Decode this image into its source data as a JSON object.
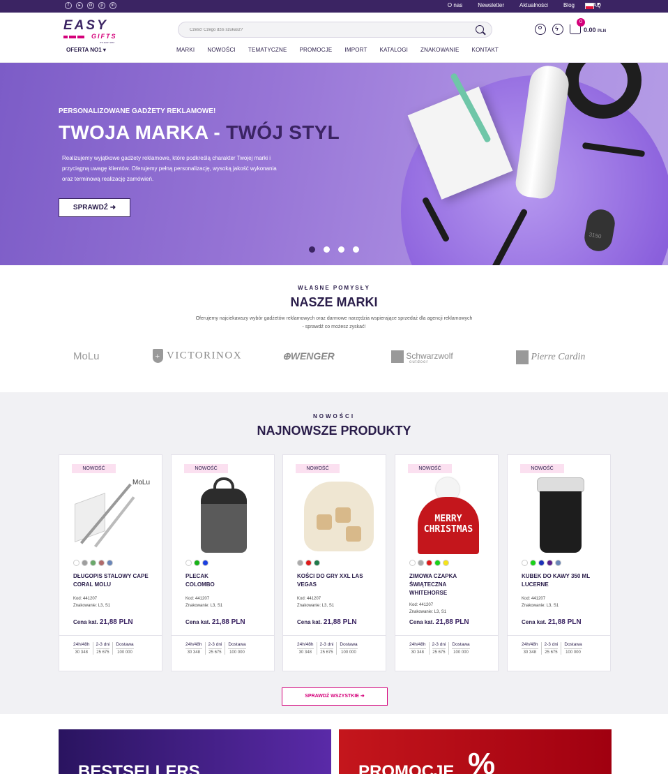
{
  "topbar": {
    "social": [
      "f",
      "yt",
      "ig",
      "pin",
      "in"
    ],
    "links": [
      "O nas",
      "Newsletter",
      "Aktualności",
      "Blog",
      "FAQ"
    ],
    "language_flag": "pl-flag-icon"
  },
  "header": {
    "logo_text": "EASY",
    "logo_sub": "GIFTS",
    "logo_tagline": "IT'S EASY WAY",
    "oferta": "OFERTA NO1",
    "search_placeholder": "Cześć! Czego dziś szukasz?",
    "cart_count": "0",
    "cart_total": "0.00",
    "cart_currency": "PLN",
    "nav": [
      "MARKI",
      "NOWOŚCI",
      "TEMATYCZNE",
      "PROMOCJE",
      "IMPORT",
      "KATALOGI",
      "ZNAKOWANIE",
      "KONTAKT"
    ]
  },
  "hero": {
    "subtitle": "PERSONALIZOWANE GADŻETY REKLAMOWE!",
    "title_a": "TWOJA MARKA - ",
    "title_b": "TWÓJ STYL",
    "text": "Realizujemy wyjątkowe gadżety reklamowe, które podkreślą charakter Twojej marki i przyciągną uwagę klientów. Oferujemy pełną personalizację, wysoką jakość wykonania oraz terminową realizację zamówień.",
    "button": "SPRAWDŹ",
    "slides": 4,
    "active_slide": 1,
    "photo_text": "3150"
  },
  "brands": {
    "label": "WŁASNE POMYSŁY",
    "title": "NASZE MARKI",
    "desc": "Oferujemy najciekawszy wybór gadżetów reklamowych oraz darmowe narzędzia wspierające sprzedaż dla agencji reklamowych - sprawdź co możesz zyskać!",
    "items": [
      "MoLu",
      "VICTORINOX",
      "WENGER",
      "Schwarzwolf",
      "Pierre Cardin"
    ],
    "schwarzwolf_sub": "outdoor"
  },
  "news": {
    "label": "NOWOŚCI",
    "title": "NAJNOWSZE PRODUKTY",
    "badge": "NOWOŚĆ",
    "price_label": "Cena kat.",
    "stock_headers": [
      "24h/48h",
      "2-3 dni",
      "Dostawa"
    ],
    "products": [
      {
        "name": "DŁUGOPIS STALOWY CAPE CORAL MOLU",
        "code": "Kod: 441207",
        "mark": "Znakowanie: L3, S1",
        "price": "21,88 PLN",
        "stock": [
          "30 348",
          "25 675",
          "100 000"
        ],
        "colors": [
          "#ffffff",
          "#9e9e9e",
          "#6aa86a",
          "#b06a6a",
          "#6a86b8"
        ],
        "image_text": "MoLu"
      },
      {
        "name": "PLECAK COLOMBO",
        "code": "Kod: 441207",
        "mark": "Znakowanie: L3, S1",
        "price": "21,88 PLN",
        "stock": [
          "30 348",
          "25 675",
          "100 000"
        ],
        "colors": [
          "#ffffff",
          "#17b317",
          "#1b3fe0"
        ]
      },
      {
        "name": "KOŚCI DO GRY XXL LAS VEGAS",
        "code": "Kod: 441207",
        "mark": "Znakowanie: L3, S1",
        "price": "21,88 PLN",
        "stock": [
          "30 348",
          "25 675",
          "100 000"
        ],
        "colors": [
          "#aaaaaa",
          "#e01919",
          "#1f7a4a"
        ]
      },
      {
        "name": "ZIMOWA CZAPKA ŚWIĄTECZNA WHITEHORSE",
        "code": "Kod: 441207",
        "mark": "Znakowanie: L3, S1",
        "price": "21,88 PLN",
        "stock": [
          "30 348",
          "25 675",
          "100 000"
        ],
        "colors": [
          "#ffffff",
          "#aaaaaa",
          "#e01919",
          "#19d119",
          "#f5e41a"
        ],
        "image_text": [
          "MERRY",
          "CHRISTMAS"
        ]
      },
      {
        "name": "KUBEK DO KAWY 350 ML LUCERNE",
        "code": "Kod: 441207",
        "mark": "Znakowanie: L3, S1",
        "price": "21,88 PLN",
        "stock": [
          "30 348",
          "25 675",
          "100 000"
        ],
        "colors": [
          "#ffffff",
          "#19d119",
          "#1b2fb8",
          "#5a1f8a",
          "#6a86b8"
        ]
      }
    ],
    "all_button": "SPRAWDŹ WSZYSTKIE"
  },
  "banners": [
    "BESTSELLERS",
    "PROMOCJE"
  ],
  "banner_sign": "%",
  "colors": {
    "brand": "#3b2463",
    "accent": "#d4007a"
  }
}
